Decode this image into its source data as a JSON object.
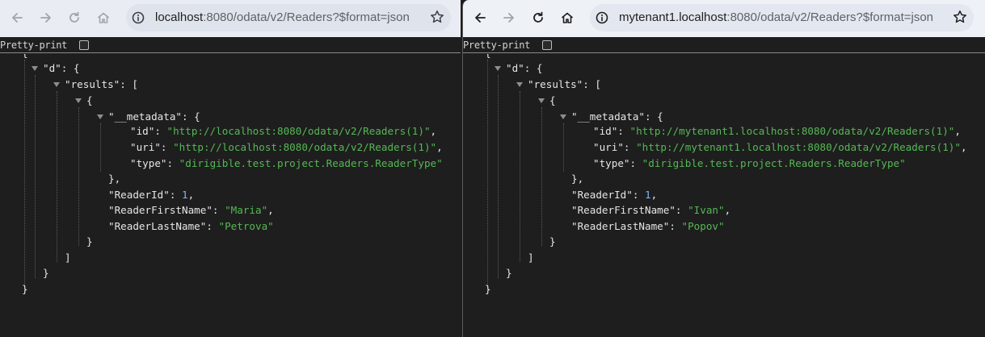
{
  "left": {
    "url_host": "localhost",
    "url_rest": ":8080/odata/v2/Readers?$format=json",
    "pretty_print_label": "Pretty-print",
    "json": {
      "open_root": "{",
      "d_key": "\"d\"",
      "d_colon": ": {",
      "results_key": "\"results\"",
      "results_colon": ": [",
      "item_open": "{",
      "meta_key": "\"__metadata\"",
      "meta_colon": ": {",
      "id_key": "\"id\"",
      "id_val": "\"http://localhost:8080/odata/v2/Readers(1)\"",
      "uri_key": "\"uri\"",
      "uri_val": "\"http://localhost:8080/odata/v2/Readers(1)\"",
      "type_key": "\"type\"",
      "type_val": "\"dirigible.test.project.Readers.ReaderType\"",
      "meta_close": "},",
      "readerid_key": "\"ReaderId\"",
      "readerid_val": "1",
      "first_key": "\"ReaderFirstName\"",
      "first_val": "\"Maria\"",
      "last_key": "\"ReaderLastName\"",
      "last_val": "\"Petrova\"",
      "item_close": "}",
      "results_close": "]",
      "d_close": "}",
      "root_close": "}"
    }
  },
  "right": {
    "url_host": "mytenant1.localhost",
    "url_rest": ":8080/odata/v2/Readers?$format=json",
    "pretty_print_label": "Pretty-print",
    "json": {
      "open_root": "{",
      "d_key": "\"d\"",
      "d_colon": ": {",
      "results_key": "\"results\"",
      "results_colon": ": [",
      "item_open": "{",
      "meta_key": "\"__metadata\"",
      "meta_colon": ": {",
      "id_key": "\"id\"",
      "id_val": "\"http://mytenant1.localhost:8080/odata/v2/Readers(1)\"",
      "uri_key": "\"uri\"",
      "uri_val": "\"http://mytenant1.localhost:8080/odata/v2/Readers(1)\"",
      "type_key": "\"type\"",
      "type_val": "\"dirigible.test.project.Readers.ReaderType\"",
      "meta_close": "},",
      "readerid_key": "\"ReaderId\"",
      "readerid_val": "1",
      "first_key": "\"ReaderFirstName\"",
      "first_val": "\"Ivan\"",
      "last_key": "\"ReaderLastName\"",
      "last_val": "\"Popov\"",
      "item_close": "}",
      "results_close": "]",
      "d_close": "}",
      "root_close": "}"
    }
  },
  "icons": {
    "back": "back-arrow-icon",
    "forward": "forward-arrow-icon",
    "reload": "reload-icon",
    "home": "home-icon",
    "site_info": "site-info-icon",
    "bookmark": "star-icon",
    "collapse": "expand-triangle-icon"
  },
  "colors": {
    "json_string": "#55b855",
    "json_number": "#7ab7ff",
    "json_key": "#e6e6e6",
    "background": "#1e1e1e",
    "toolbar": "#e9ecf3"
  }
}
